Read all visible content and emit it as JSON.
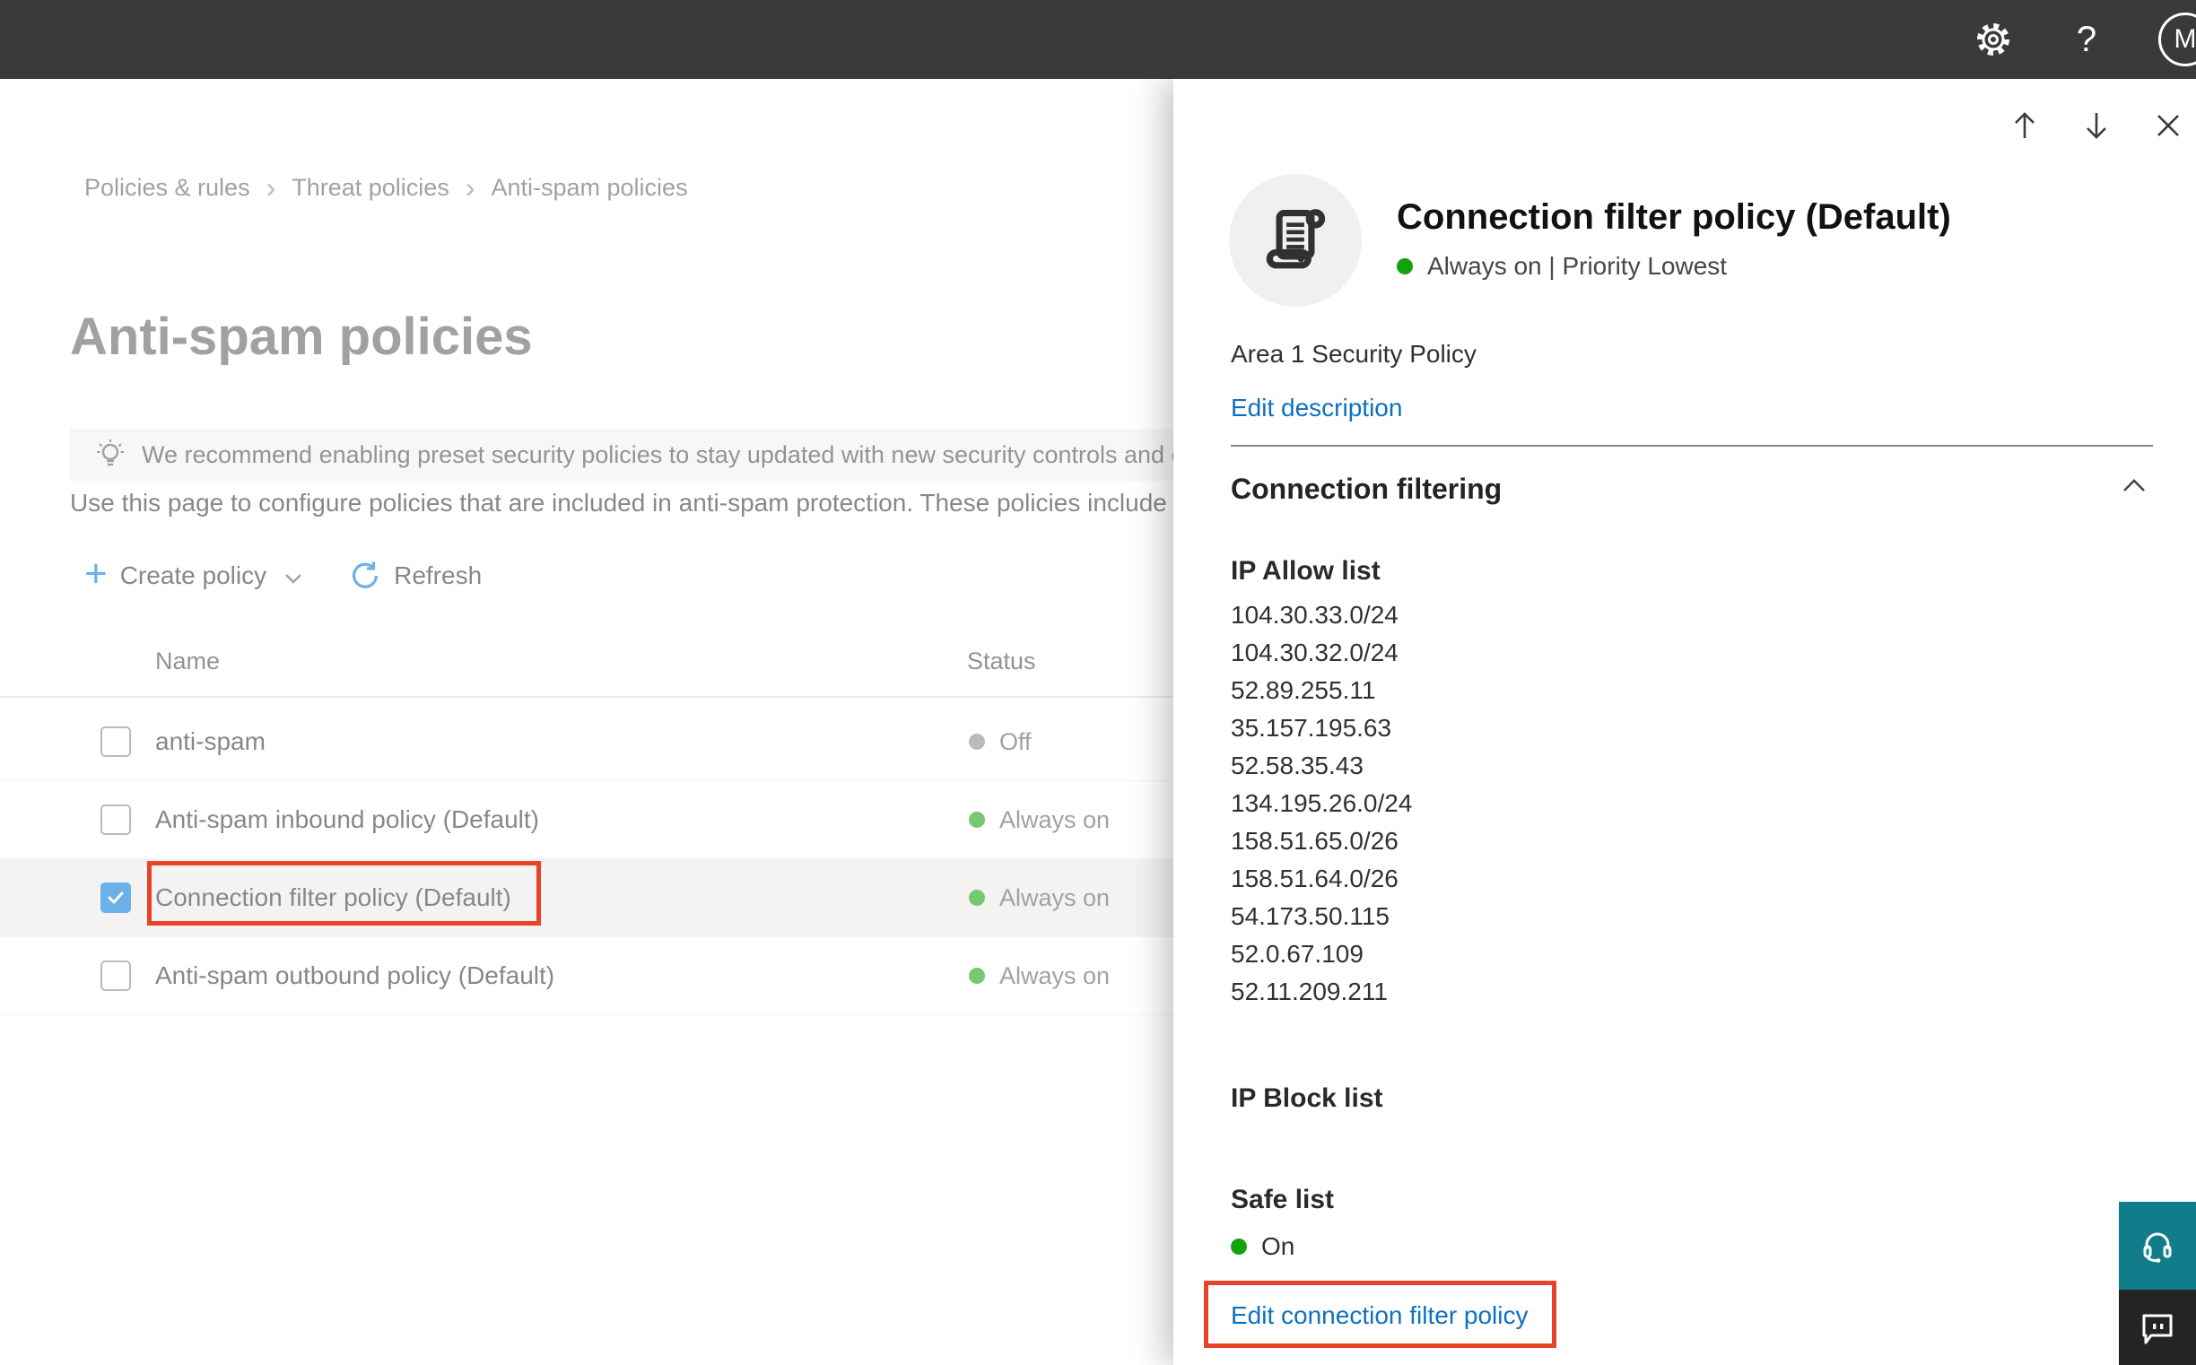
{
  "topbar": {
    "help_label": "?",
    "avatar_initial": "M"
  },
  "breadcrumb": {
    "separator": "›",
    "items": [
      "Policies & rules",
      "Threat policies",
      "Anti-spam policies"
    ]
  },
  "page": {
    "title": "Anti-spam policies",
    "banner_text": "We recommend enabling preset security policies to stay updated with new security controls and our recomme",
    "description": "Use this page to configure policies that are included in anti-spam protection. These policies include",
    "toolbar": {
      "create_policy_label": "Create policy",
      "refresh_label": "Refresh"
    }
  },
  "table": {
    "columns": [
      "Name",
      "Status"
    ],
    "rows": [
      {
        "name": "anti-spam",
        "status": "Off"
      },
      {
        "name": "Anti-spam inbound policy (Default)",
        "status": "Always on"
      },
      {
        "name": "Connection filter policy (Default)",
        "status": "Always on"
      },
      {
        "name": "Anti-spam outbound policy (Default)",
        "status": "Always on"
      }
    ]
  },
  "flyout": {
    "title": "Connection filter policy (Default)",
    "status_line": "Always on | Priority Lowest",
    "description": "Area 1 Security Policy",
    "edit_description_label": "Edit description",
    "section_title": "Connection filtering",
    "ip_allow": {
      "title": "IP Allow list",
      "items": [
        "104.30.33.0/24",
        "104.30.32.0/24",
        "52.89.255.11",
        "35.157.195.63",
        "52.58.35.43",
        "134.195.26.0/24",
        "158.51.65.0/26",
        "158.51.64.0/26",
        "54.173.50.115",
        "52.0.67.109",
        "52.11.209.211"
      ]
    },
    "ip_block": {
      "title": "IP Block list"
    },
    "safe_list": {
      "title": "Safe list",
      "status": "On"
    },
    "edit_link_label": "Edit connection filter policy"
  },
  "colors": {
    "accent_blue": "#0078d4",
    "status_green": "#13a10e",
    "status_off_gray": "#8a8886",
    "annotation_red": "#e8432a",
    "support_teal": "#117d8a",
    "topbar_dark": "#3b3a39"
  }
}
